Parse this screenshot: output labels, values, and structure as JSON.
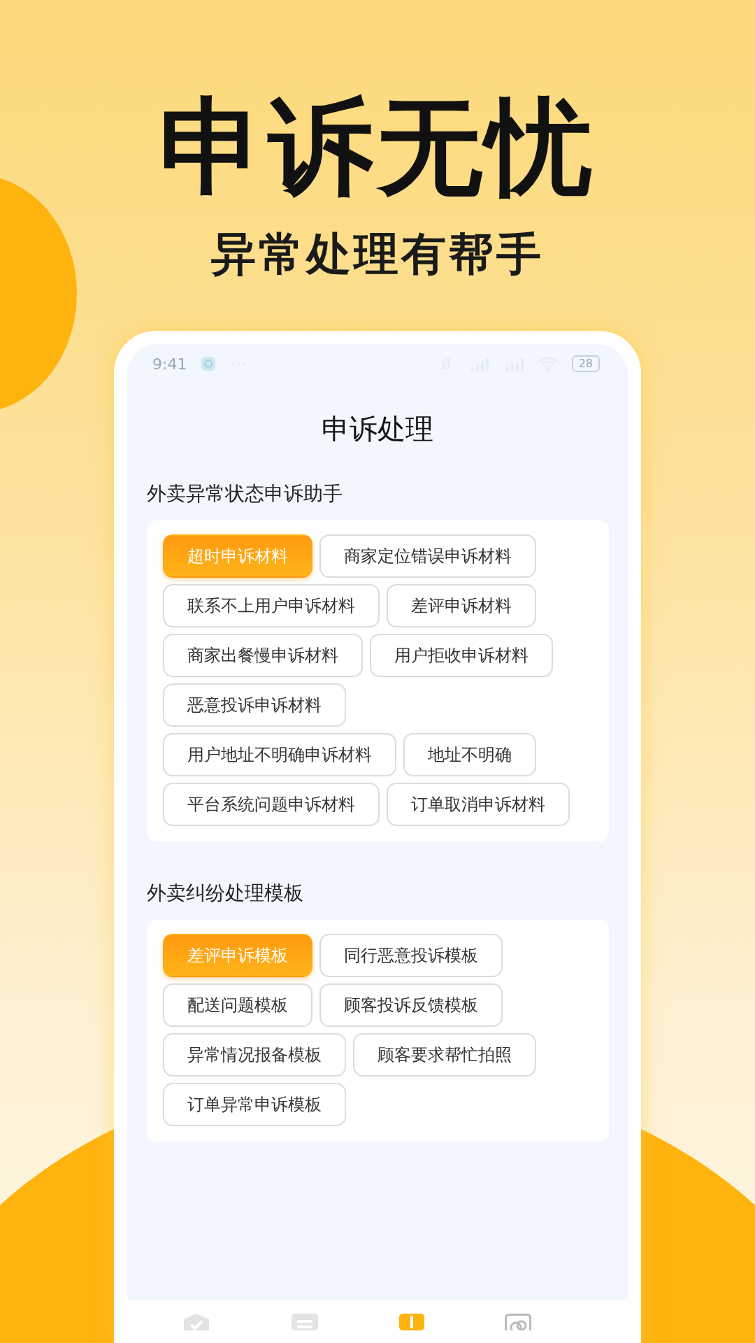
{
  "headline": "申诉无忧",
  "subheadline": "异常处理有帮手",
  "status_bar": {
    "time": "9:41",
    "battery": "28"
  },
  "screen_title": "申诉处理",
  "sections": [
    {
      "title": "外卖异常状态申诉助手",
      "items": [
        {
          "label": "超时申诉材料",
          "selected": true
        },
        {
          "label": "商家定位错误申诉材料",
          "selected": false
        },
        {
          "label": "联系不上用户申诉材料",
          "selected": false
        },
        {
          "label": "差评申诉材料",
          "selected": false
        },
        {
          "label": "商家出餐慢申诉材料",
          "selected": false
        },
        {
          "label": "用户拒收申诉材料",
          "selected": false
        },
        {
          "label": "恶意投诉申诉材料",
          "selected": false
        },
        {
          "label": "用户地址不明确申诉材料",
          "selected": false
        },
        {
          "label": "地址不明确",
          "selected": false
        },
        {
          "label": "平台系统问题申诉材料",
          "selected": false
        },
        {
          "label": "订单取消申诉材料",
          "selected": false
        }
      ]
    },
    {
      "title": "外卖纠纷处理模板",
      "items": [
        {
          "label": "差评申诉模板",
          "selected": true
        },
        {
          "label": "同行恶意投诉模板",
          "selected": false
        },
        {
          "label": "配送问题模板",
          "selected": false
        },
        {
          "label": "顾客投诉反馈模板",
          "selected": false
        },
        {
          "label": "异常情况报备模板",
          "selected": false
        },
        {
          "label": "顾客要求帮忙拍照",
          "selected": false
        },
        {
          "label": "订单异常申诉模板",
          "selected": false
        }
      ]
    }
  ],
  "bottom_nav": [
    {
      "kind": "shield",
      "selected": false
    },
    {
      "kind": "document",
      "selected": false
    },
    {
      "kind": "clipboard",
      "selected": true
    },
    {
      "kind": "gallery",
      "selected": false
    }
  ]
}
